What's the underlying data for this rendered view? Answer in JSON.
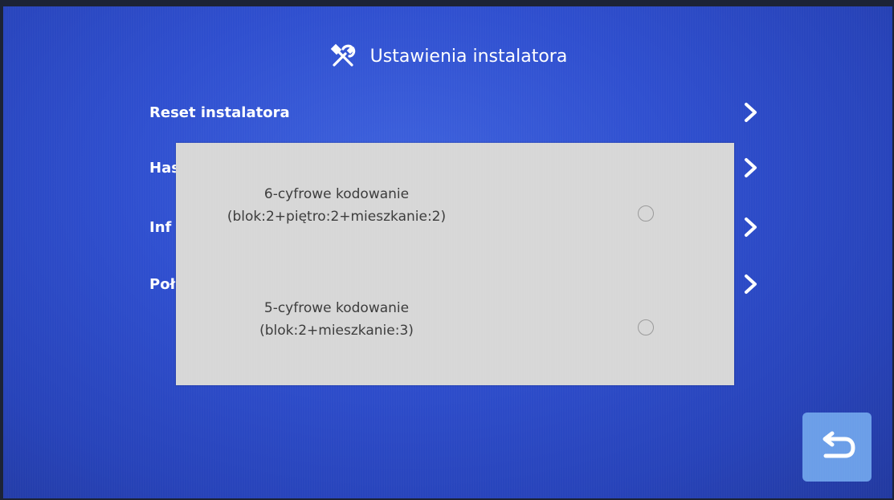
{
  "header": {
    "title": "Ustawienia instalatora",
    "icon": "tools-icon"
  },
  "menu": {
    "items": [
      {
        "label": "Reset instalatora",
        "icon": "chevron-right-icon"
      },
      {
        "label": "Has",
        "icon": "chevron-right-icon"
      },
      {
        "label": "Inf",
        "icon": "chevron-right-icon"
      },
      {
        "label": "Poł",
        "icon": "chevron-right-icon"
      }
    ]
  },
  "dialog": {
    "options": [
      {
        "line1": "6-cyfrowe kodowanie",
        "line2": "(blok:2+piętro:2+mieszkanie:2)",
        "selected": false
      },
      {
        "line1": "5-cyfrowe kodowanie",
        "line2": "(blok:2+mieszkanie:3)",
        "selected": false
      }
    ]
  },
  "footer": {
    "back_icon": "back-arrow-icon"
  },
  "colors": {
    "background": "#2f4fcf",
    "dialog": "#d7d7d7",
    "back_button": "#6b9ee8",
    "text": "#ffffff"
  }
}
